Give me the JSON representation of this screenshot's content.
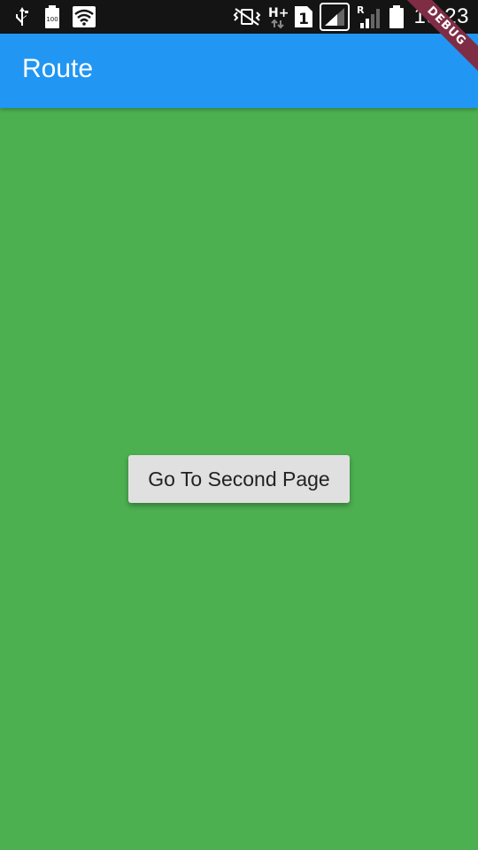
{
  "status_bar": {
    "time": "19:23",
    "battery_small_label": "100",
    "network_type": "H+",
    "sim_slot": "1",
    "roaming_indicator": "R",
    "icons": [
      "usb-icon",
      "battery-100-icon",
      "wifi-icon",
      "vibrate-icon",
      "network-hplus-icon",
      "sim1-icon",
      "signal-icon",
      "signal-roaming-icon",
      "battery-icon"
    ]
  },
  "app_bar": {
    "title": "Route",
    "color": "#2196f3"
  },
  "debug_banner": {
    "label": "DEBUG",
    "color": "#7e2d45"
  },
  "body": {
    "background": "#4caf50",
    "button_label": "Go To Second Page"
  }
}
